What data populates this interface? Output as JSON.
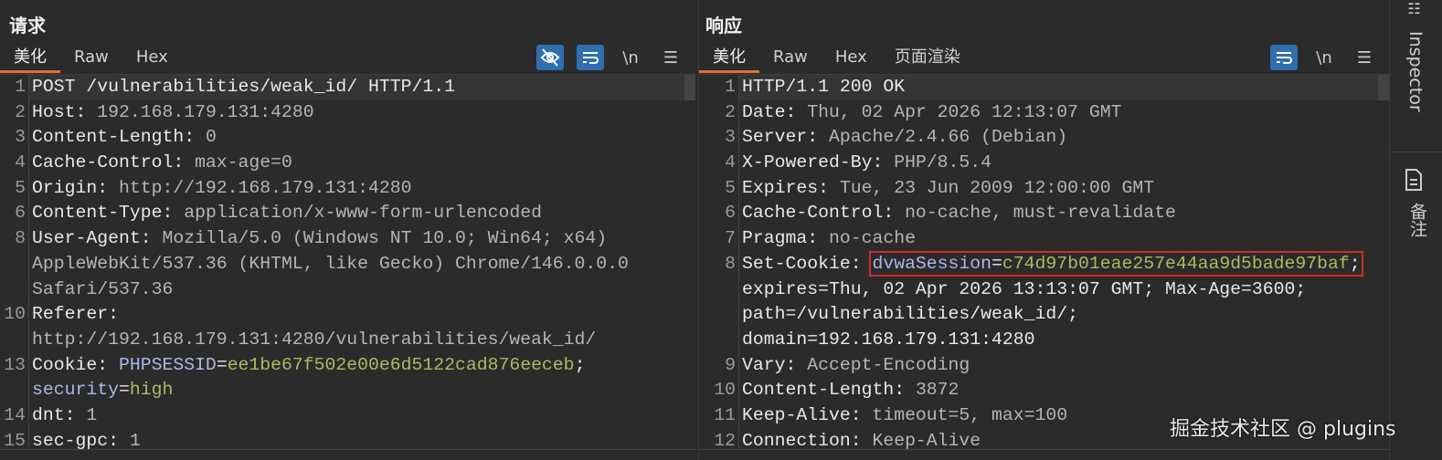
{
  "request": {
    "title": "请求",
    "tabs": [
      "美化",
      "Raw",
      "Hex"
    ],
    "tools": {
      "wrap": "\\n",
      "menu": "☰"
    },
    "rows": [
      {
        "n": "1",
        "cur": true,
        "p": [
          [
            "k",
            "POST /vulnerabilities/weak_id/ HTTP/1.1"
          ]
        ]
      },
      {
        "n": "2",
        "p": [
          [
            "k",
            "Host: "
          ],
          [
            "v",
            "192.168.179.131:4280"
          ]
        ]
      },
      {
        "n": "3",
        "p": [
          [
            "k",
            "Content-Length: "
          ],
          [
            "v",
            "0"
          ]
        ]
      },
      {
        "n": "4",
        "p": [
          [
            "k",
            "Cache-Control: "
          ],
          [
            "v",
            "max-age=0"
          ]
        ]
      },
      {
        "n": "5",
        "p": [
          [
            "k",
            "Origin: "
          ],
          [
            "v",
            "http://192.168.179.131:4280"
          ]
        ]
      },
      {
        "n": "6",
        "p": [
          [
            "k",
            "Content-Type: "
          ],
          [
            "v",
            "application/x-www-form-urlencoded"
          ]
        ]
      },
      {
        "n": "8",
        "p": [
          [
            "k",
            "User-Agent: "
          ],
          [
            "v",
            "Mozilla/5.0 (Windows NT 10.0; Win64; x64)"
          ]
        ]
      },
      {
        "n": "",
        "p": [
          [
            "v",
            "AppleWebKit/537.36 (KHTML, like Gecko) Chrome/146.0.0.0"
          ]
        ]
      },
      {
        "n": "",
        "p": [
          [
            "v",
            "Safari/537.36"
          ]
        ]
      },
      {
        "n": "10",
        "p": [
          [
            "k",
            "Referer: "
          ]
        ]
      },
      {
        "n": "",
        "p": [
          [
            "v",
            "http://192.168.179.131:4280/vulnerabilities/weak_id/"
          ]
        ]
      },
      {
        "n": "13",
        "p": [
          [
            "k",
            "Cookie: "
          ],
          [
            "cn",
            "PHPSESSID"
          ],
          [
            "k",
            "="
          ],
          [
            "cv",
            "ee1be67f502e00e6d5122cad876eeceb"
          ],
          [
            "k",
            ";"
          ]
        ]
      },
      {
        "n": "",
        "p": [
          [
            "cn",
            "security"
          ],
          [
            "k",
            "="
          ],
          [
            "cv",
            "high"
          ]
        ]
      },
      {
        "n": "14",
        "p": [
          [
            "k",
            "dnt: "
          ],
          [
            "v",
            "1"
          ]
        ]
      },
      {
        "n": "15",
        "p": [
          [
            "k",
            "sec-gpc: "
          ],
          [
            "v",
            "1"
          ]
        ]
      }
    ]
  },
  "response": {
    "title": "响应",
    "tabs": [
      "美化",
      "Raw",
      "Hex",
      "页面渲染"
    ],
    "tools": {
      "wrap": "\\n",
      "menu": "☰"
    },
    "rows": [
      {
        "n": "1",
        "cur": true,
        "p": [
          [
            "k",
            "HTTP/1.1 200 OK"
          ]
        ]
      },
      {
        "n": "2",
        "p": [
          [
            "k",
            "Date: "
          ],
          [
            "v",
            "Thu, 02 Apr 2026 12:13:07 GMT"
          ]
        ]
      },
      {
        "n": "3",
        "p": [
          [
            "k",
            "Server: "
          ],
          [
            "v",
            "Apache/2.4.66 (Debian)"
          ]
        ]
      },
      {
        "n": "4",
        "p": [
          [
            "k",
            "X-Powered-By: "
          ],
          [
            "v",
            "PHP/8.5.4"
          ]
        ]
      },
      {
        "n": "5",
        "p": [
          [
            "k",
            "Expires: "
          ],
          [
            "v",
            "Tue, 23 Jun 2009 12:00:00 GMT"
          ]
        ]
      },
      {
        "n": "6",
        "p": [
          [
            "k",
            "Cache-Control: "
          ],
          [
            "v",
            "no-cache, must-revalidate"
          ]
        ]
      },
      {
        "n": "7",
        "p": [
          [
            "k",
            "Pragma: "
          ],
          [
            "v",
            "no-cache"
          ]
        ]
      },
      {
        "n": "8",
        "p": [
          [
            "k",
            "Set-Cookie: "
          ],
          [
            "cn",
            "dvwaSession",
            "hl"
          ],
          [
            "k",
            "=",
            "hl"
          ],
          [
            "cv",
            "c74d97b01eae257e44aa9d5bade97baf",
            "hl"
          ],
          [
            "k",
            ";",
            "hl"
          ]
        ]
      },
      {
        "n": "",
        "p": [
          [
            "k",
            "expires=Thu, 02 Apr 2026 13:13:07 GMT; Max-Age=3600;"
          ]
        ]
      },
      {
        "n": "",
        "p": [
          [
            "k",
            "path=/vulnerabilities/weak_id/;"
          ]
        ]
      },
      {
        "n": "",
        "p": [
          [
            "k",
            "domain=192.168.179.131:4280"
          ]
        ]
      },
      {
        "n": "9",
        "p": [
          [
            "k",
            "Vary: "
          ],
          [
            "v",
            "Accept-Encoding"
          ]
        ]
      },
      {
        "n": "10",
        "p": [
          [
            "k",
            "Content-Length: "
          ],
          [
            "v",
            "3872"
          ]
        ]
      },
      {
        "n": "11",
        "p": [
          [
            "k",
            "Keep-Alive: "
          ],
          [
            "v",
            "timeout=5, max=100"
          ]
        ]
      },
      {
        "n": "12",
        "p": [
          [
            "k",
            "Connection: "
          ],
          [
            "v",
            "Keep-Alive"
          ]
        ]
      }
    ]
  },
  "sidebar": {
    "inspector": "Inspector",
    "notes": "备注"
  },
  "watermark": "掘金技术社区 @ plugins"
}
